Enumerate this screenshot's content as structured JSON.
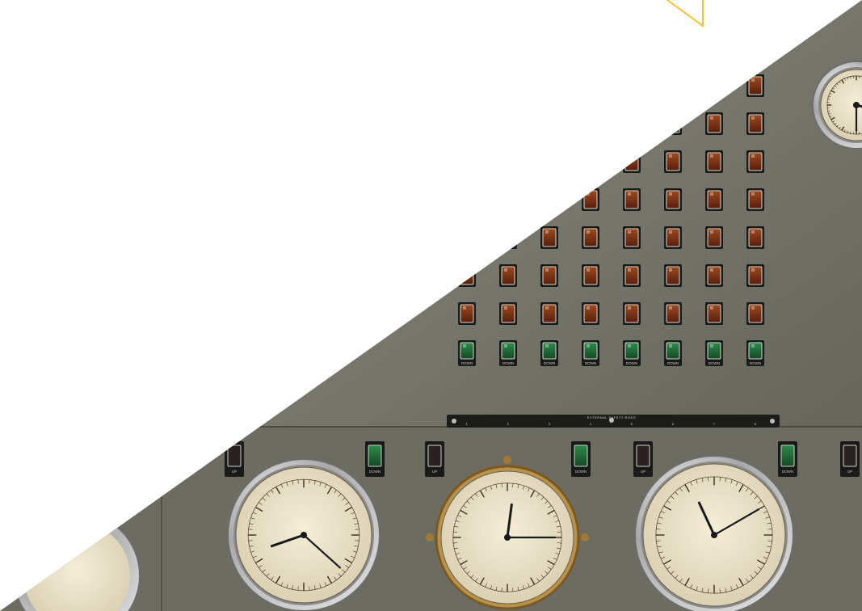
{
  "photo": {
    "subject": "control-panel",
    "colors": {
      "background": "#ffffff",
      "panel": "#77776c",
      "panel_dark": "#55554c",
      "amber_lamp": "#7a2e12",
      "green_lamp": "#1f6b38",
      "dial_face": "#ece4cc",
      "chrome": "#c9c9c9",
      "accent_outline": "#f2c12e"
    },
    "lamp_grid": {
      "columns": 8,
      "amber_rows": 7,
      "green_rows": 1,
      "green_label": "DOWN"
    },
    "safety_plate": {
      "label": "EXTERNAL SAFETY RODS",
      "numbers": [
        "1",
        "2",
        "3",
        "4",
        "5",
        "6",
        "7",
        "8"
      ]
    },
    "lower_buttons": [
      {
        "label": "UP",
        "color": "dark"
      },
      {
        "label": "DOWN",
        "color": "green"
      },
      {
        "label": "UP",
        "color": "dark"
      },
      {
        "label": "DOWN",
        "color": "green"
      },
      {
        "label": "UP",
        "color": "dark"
      },
      {
        "label": "DOWN",
        "color": "green"
      },
      {
        "label": "UP",
        "color": "dark"
      }
    ],
    "dials": [
      {
        "name": "dial-1",
        "style": "chrome",
        "hour": 8,
        "minute": 22
      },
      {
        "name": "dial-2",
        "style": "brass",
        "hour": 12,
        "minute": 15
      },
      {
        "name": "dial-3",
        "style": "chrome",
        "hour": 11,
        "minute": 10
      },
      {
        "name": "dial-top-right",
        "style": "chrome",
        "hour": 3,
        "minute": 30
      }
    ]
  }
}
